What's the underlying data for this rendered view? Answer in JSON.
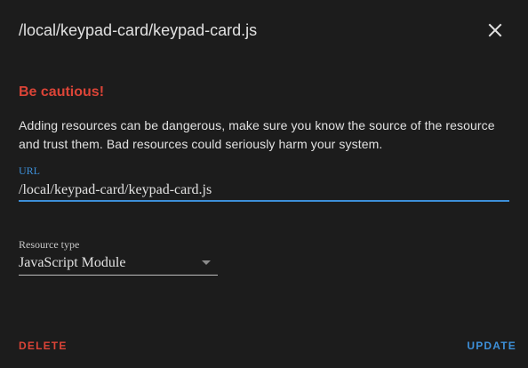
{
  "dialog": {
    "title": "/local/keypad-card/keypad-card.js",
    "close_icon": "close-icon"
  },
  "warning": {
    "title": "Be cautious!",
    "text": "Adding resources can be dangerous, make sure you know the source of the resource and trust them. Bad resources could seriously harm your system."
  },
  "url_field": {
    "label": "URL",
    "value": "/local/keypad-card/keypad-card.js"
  },
  "resource_type": {
    "label": "Resource type",
    "selected": "JavaScript Module",
    "arrow_icon": "dropdown-arrow-icon"
  },
  "actions": {
    "delete_label": "DELETE",
    "update_label": "UPDATE"
  },
  "colors": {
    "background": "#1c1c1c",
    "warning": "#db4437",
    "accent": "#3d8fd8",
    "text": "#e1e1e1"
  }
}
